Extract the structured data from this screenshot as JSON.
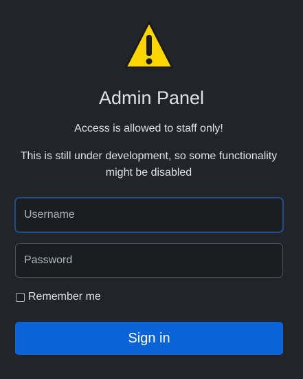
{
  "header": {
    "icon": "warning-icon",
    "title": "Admin Panel",
    "notice": "Access is allowed to staff only!",
    "dev_notice": "This is still under development, so some functionality might be disabled"
  },
  "form": {
    "username_placeholder": "Username",
    "password_placeholder": "Password",
    "remember_label": "Remember me",
    "remember_checked": false,
    "submit_label": "Sign in"
  },
  "colors": {
    "background": "#212529",
    "accent": "#0b63d8",
    "warning": "#ffd500"
  }
}
